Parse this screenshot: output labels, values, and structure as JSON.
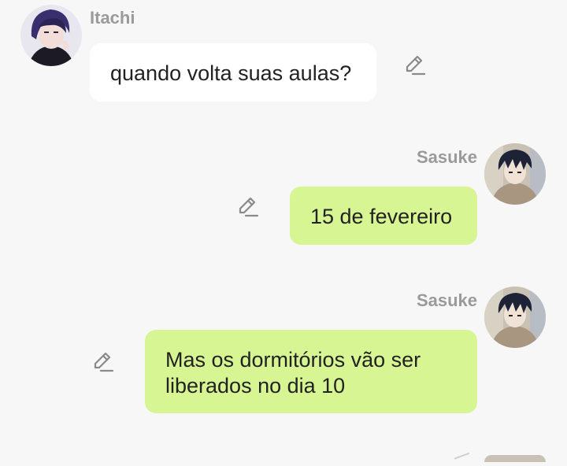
{
  "messages": [
    {
      "sender": "Itachi",
      "text": "quando volta suas aulas?",
      "direction": "incoming",
      "avatar_icon": "itachi-avatar"
    },
    {
      "sender": "Sasuke",
      "text": "15 de fevereiro",
      "direction": "outgoing",
      "avatar_icon": "sasuke-avatar"
    },
    {
      "sender": "Sasuke",
      "text": "Mas os dormitórios vão ser liberados no dia 10",
      "direction": "outgoing",
      "avatar_icon": "sasuke-avatar"
    }
  ],
  "colors": {
    "background": "#f7f7f7",
    "incoming_bubble": "#ffffff",
    "outgoing_bubble": "#d8f593",
    "sender_name": "#9a9a9a",
    "edit_icon": "#8a8a8a"
  },
  "icons": {
    "edit": "pencil-edit-icon"
  }
}
